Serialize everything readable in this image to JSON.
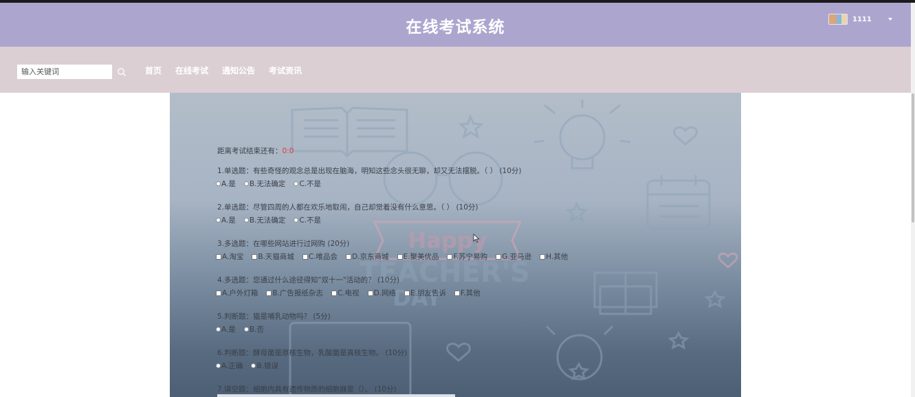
{
  "header": {
    "site_title": "在线考试系统",
    "username": "1111"
  },
  "nav": {
    "search_placeholder": "输入关键词",
    "links": [
      "首页",
      "在线考试",
      "通知公告",
      "考试资讯"
    ]
  },
  "exam": {
    "timer_label": "距离考试结束还有：",
    "timer_value": "0:0",
    "questions": [
      {
        "title": "1.单选题：有些奇怪的观念总是出现在脑海，明知这些念头很无聊，却又无法摆脱。（ ）  (10分)",
        "type": "radio",
        "options": [
          "A.是",
          "B.无法确定",
          "C.不是"
        ]
      },
      {
        "title": "2.单选题：尽管四周的人都在欢乐地取闹，自己却觉着没有什么意思。（ ）  (10分)",
        "type": "radio",
        "options": [
          "A.是",
          "B.无法确定",
          "C.不是"
        ]
      },
      {
        "title": "3.多选题：在哪些网站进行过网购 (20分)",
        "type": "checkbox",
        "options": [
          "A.淘宝",
          "B.天猫商城",
          "C.唯品会",
          "D.京东商城",
          "E.聚美优品",
          "F.苏宁易购",
          "G.亚马逊",
          "H.其他"
        ]
      },
      {
        "title": "4.多选题：您通过什么途径得知\"双十一\"活动的？ (10分)",
        "type": "checkbox",
        "options": [
          "A.户外灯箱",
          "B.广告报纸杂志",
          "C.电视",
          "D.网络",
          "E.朋友告诉",
          "F.其他"
        ]
      },
      {
        "title": "5.判断题：猫是哺乳动物吗？ (5分)",
        "type": "radio",
        "options": [
          "A.是",
          "B.否"
        ]
      },
      {
        "title": "6.判断题：酵母菌是原核生物，乳酸菌是真核生物。 (10分)",
        "type": "radio",
        "options": [
          "A.正确",
          "B.错误"
        ]
      },
      {
        "title": "7.填空题：细胞内具有遗传物质的细胞器是（）。 (10分)",
        "type": "fill",
        "options": []
      }
    ]
  },
  "background": {
    "watermark_line1": "Happy",
    "watermark_line2": "TEACHER'S",
    "watermark_line3": "DAY"
  },
  "colors": {
    "header_bg": "#aca6cf",
    "nav_bg": "#dccfd4",
    "timer_value": "#e03a3a"
  }
}
